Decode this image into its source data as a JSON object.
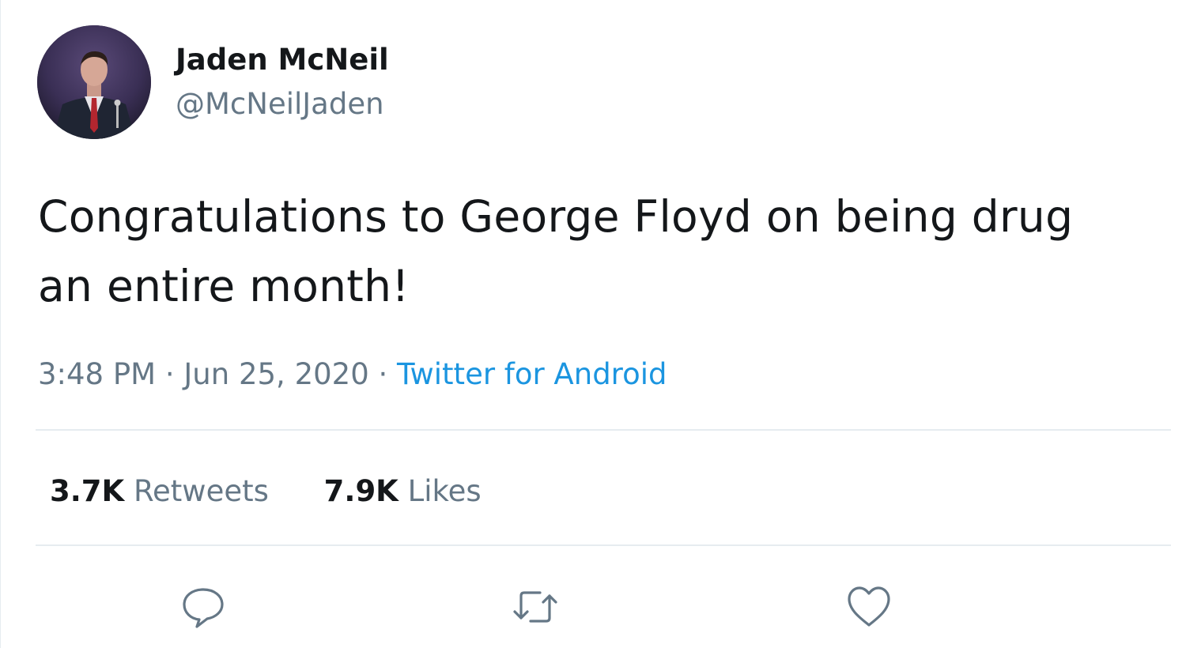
{
  "tweet": {
    "author": {
      "display_name": "Jaden McNeil",
      "handle": "@McNeilJaden"
    },
    "text": "Congratulations to George Floyd on being drug\nan entire month!",
    "time": "3:48 PM",
    "separator": " · ",
    "date": "Jun 25, 2020",
    "source": "Twitter for Android",
    "stats": {
      "retweets_count": "3.7K",
      "retweets_label": "Retweets",
      "likes_count": "7.9K",
      "likes_label": "Likes"
    },
    "actions": {
      "reply_icon": "reply-icon",
      "retweet_icon": "retweet-icon",
      "like_icon": "heart-icon"
    }
  },
  "colors": {
    "text_primary": "#14171a",
    "text_secondary": "#657786",
    "link": "#1b95e0",
    "divider": "#e6ecf0"
  }
}
